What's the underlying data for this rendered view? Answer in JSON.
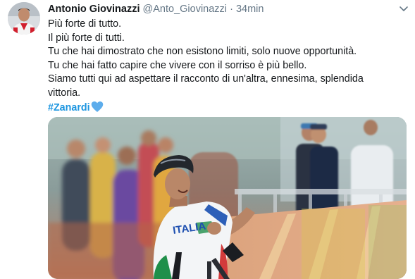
{
  "tweet": {
    "author_name": "Antonio Giovinazzi",
    "handle": "@Anto_Giovinazzi",
    "separator": "·",
    "time": "34min",
    "lines": [
      "Più forte di tutto.",
      "Il più forte di tutti.",
      "Tu che hai dimostrato che non esistono limiti, solo nuove opportunità.",
      "Tu che hai fatto capire che vivere con il sorriso è più bello.",
      "Siamo tutti qui ad aspettare il racconto di un'altra, ennesima, splendida",
      "vittoria."
    ],
    "hashtag": "#Zanardi",
    "hashtag_emoji": "blue-heart-icon",
    "jersey_text": "ITALIA"
  },
  "icons": {
    "avatar": "avatar",
    "caret": "chevron-down-icon"
  },
  "colors": {
    "link_blue": "#1b95e0",
    "secondary_text": "#657786",
    "heart_blue": "#5dadec"
  }
}
